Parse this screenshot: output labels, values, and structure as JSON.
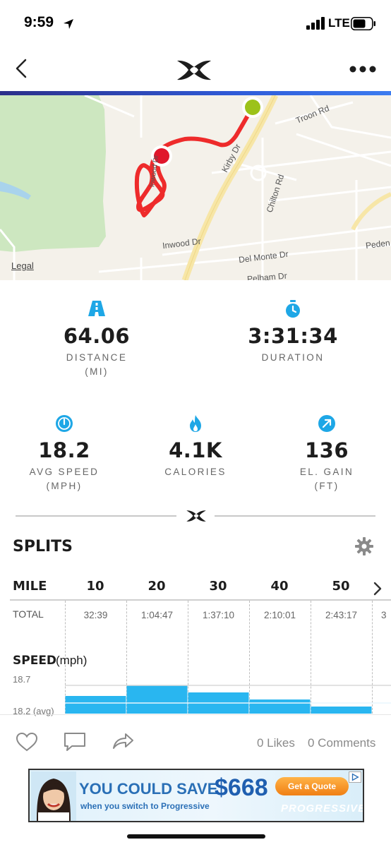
{
  "status_bar": {
    "time": "9:59",
    "network": "LTE",
    "icons": [
      "location-arrow-icon",
      "signal-icon",
      "battery-icon"
    ]
  },
  "nav": {
    "icons": [
      "back-icon",
      "under-armour-logo",
      "more-icon"
    ],
    "accent": "#2f5bd8"
  },
  "map": {
    "legal": "Legal",
    "streets": [
      "Troon Rd",
      "Kirby Dr",
      "Chilton Rd",
      "Inwood Dr",
      "Del Monte Dr",
      "Peden",
      "Pelham Dr",
      "Inwood Dr"
    ],
    "start_color": "#9cc21a",
    "end_color": "#e0162b",
    "route_color": "#ee2b2b"
  },
  "stats": {
    "distance": {
      "value": "64.06",
      "label": "DISTANCE",
      "unit": "(MI)",
      "icon": "road-icon"
    },
    "duration": {
      "value": "3:31:34",
      "label": "DURATION",
      "unit": "",
      "icon": "stopwatch-icon"
    },
    "avg_speed": {
      "value": "18.2",
      "label": "AVG SPEED",
      "unit": "(MPH)",
      "icon": "speedometer-icon"
    },
    "calories": {
      "value": "4.1K",
      "label": "CALORIES",
      "unit": "",
      "icon": "flame-icon"
    },
    "el_gain": {
      "value": "136",
      "label": "EL. GAIN",
      "unit": "(FT)",
      "icon": "arrow-up-right-icon"
    },
    "icon_color": "#1ea7e6"
  },
  "splits": {
    "title": "SPLITS",
    "mile_label": "MILE",
    "miles": [
      "10",
      "20",
      "30",
      "40",
      "50"
    ],
    "total_label": "TOTAL",
    "totals": [
      "32:39",
      "1:04:47",
      "1:37:10",
      "2:10:01",
      "2:43:17",
      "3"
    ],
    "speed_title": "SPEED",
    "speed_unit": "(mph)",
    "speed_max_label": "18.7",
    "speed_avg_label": "18.2 (avg)",
    "bar_color": "#29b6f0"
  },
  "chart_data": {
    "type": "bar",
    "categories": [
      "10",
      "20",
      "30",
      "40",
      "50"
    ],
    "values": [
      18.4,
      18.7,
      18.5,
      18.3,
      18.1
    ],
    "ylabel": "SPEED (mph)",
    "ylim": [
      17.9,
      18.7
    ],
    "reference_lines": [
      18.7,
      18.2
    ]
  },
  "social": {
    "likes": "0 Likes",
    "comments": "0 Comments"
  },
  "ad": {
    "headline": "YOU COULD SAVE",
    "amount": "$668",
    "subline": "when you switch to Progressive",
    "cta": "Get a Quote",
    "brand": "PROGRESSIVE"
  }
}
